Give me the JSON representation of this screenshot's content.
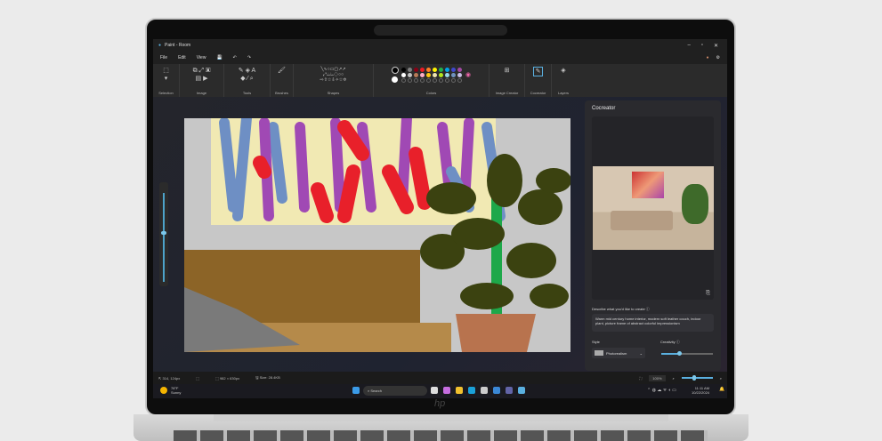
{
  "window": {
    "title": "Paint - Room"
  },
  "menu": [
    "File",
    "Edit",
    "View"
  ],
  "ribbon": {
    "groups": [
      "Selection",
      "Image",
      "Tools",
      "Brushes",
      "Shapes",
      "Colors",
      "Image Creator",
      "Cocreator",
      "Layers"
    ]
  },
  "colors": {
    "row1": [
      "#000000",
      "#7f7f7f",
      "#880015",
      "#ed1c24",
      "#ff7f27",
      "#fff200",
      "#22b14c",
      "#00a2e8",
      "#3f48cc",
      "#a349a4"
    ],
    "row2": [
      "#ffffff",
      "#c3c3c3",
      "#b97a57",
      "#ffaec9",
      "#ffc90e",
      "#efe4b0",
      "#b5e61d",
      "#99d9ea",
      "#7092be",
      "#c8bfe7"
    ],
    "primary": "#000000",
    "secondary": "#ffffff"
  },
  "cocreator": {
    "title": "Cocreator",
    "describe_label": "Describe what you'd like to create",
    "prompt": "Warm mid century home interior, modern soft leather couch, indoor plant, picture frame of abstract colorful impressionism",
    "style_label": "Style",
    "style_value": "Photorealism",
    "creativity_label": "Creativity",
    "creativity_level": 0.35
  },
  "status": {
    "cursor": "314, 124px",
    "dimensions": "982 × 630px",
    "size": "Size: 28.4KB",
    "zoom": "100%"
  },
  "taskbar": {
    "weather_temp": "78°F",
    "weather_text": "Sunny",
    "search": "Search",
    "time": "11:11 AM",
    "date": "10/22/2024"
  },
  "brand": "hp"
}
